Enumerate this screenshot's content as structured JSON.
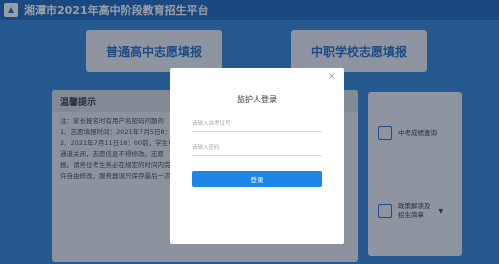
{
  "header": {
    "title": "湘潭市2021年高中阶段教育招生平台"
  },
  "tiles": {
    "regular": "普通高中志愿填报",
    "vocational": "中职学校志愿填报"
  },
  "notice": {
    "title": "温馨提示",
    "lines": [
      "注：家长报名时有用户名密码问题的",
      "1、志愿填报时间：2021年7月5日8：",
      "2、2021年7月11日18：00前，学生可",
      "通道关闭，志愿信息不得修改。志愿",
      "报。请务位考生务必在规定的时间内完",
      "许自由修改，服务器误只保存最后一次"
    ]
  },
  "side": {
    "score_query": "中考成绩查询",
    "policy_line1": "政策解读及",
    "policy_line2": "招生简章"
  },
  "modal": {
    "title": "监护人登录",
    "close": "×",
    "id_placeholder": "请输入准考证号",
    "pwd_placeholder": "请输入密码",
    "login": "登录"
  }
}
